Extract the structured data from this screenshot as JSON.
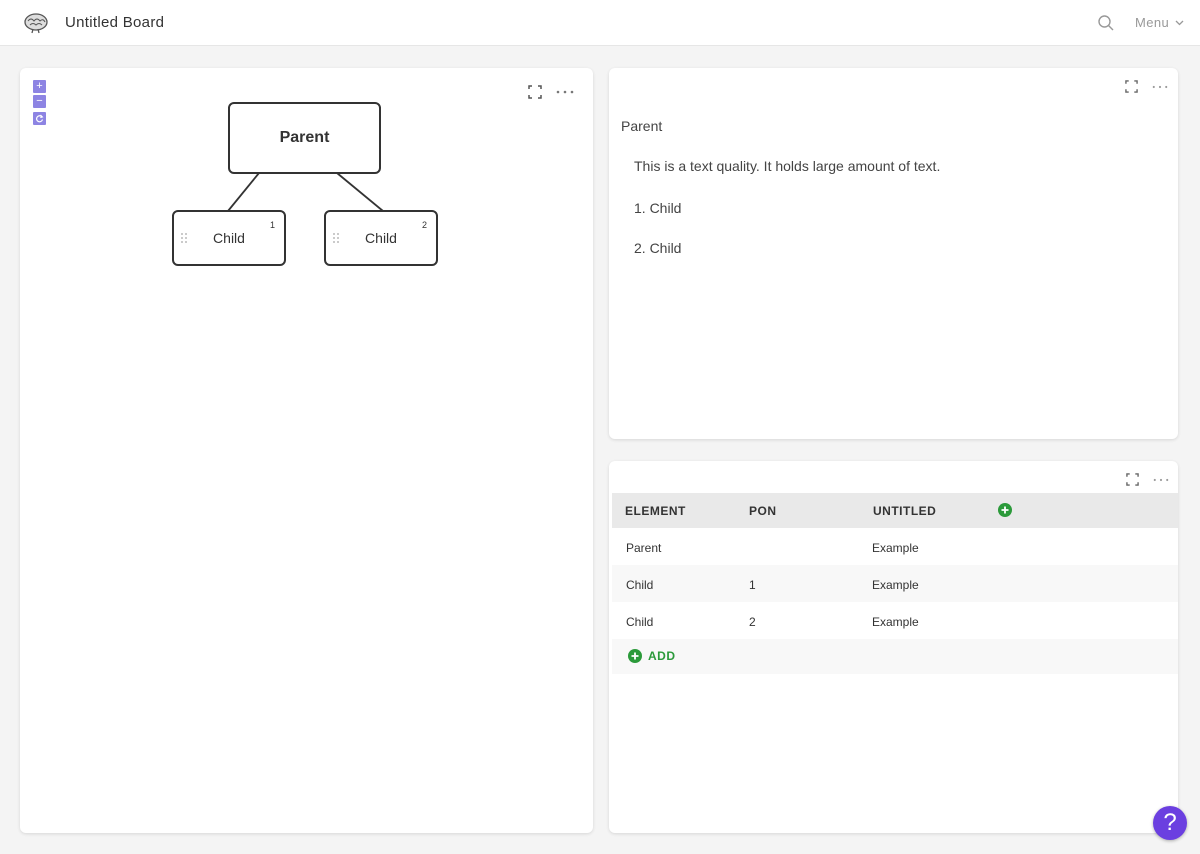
{
  "header": {
    "title": "Untitled Board",
    "menu_label": "Menu"
  },
  "diagram": {
    "zoom_in": "+",
    "zoom_out": "−",
    "nodes": [
      {
        "label": "Parent"
      },
      {
        "label": "Child",
        "number": "1"
      },
      {
        "label": "Child",
        "number": "2"
      }
    ]
  },
  "text_panel": {
    "heading": "Parent",
    "body": "This is a text quality. It holds large amount of text.",
    "list": [
      "1. Child",
      "2. Child"
    ]
  },
  "table": {
    "columns": [
      "ELEMENT",
      "PON",
      "UNTITLED"
    ],
    "rows": [
      [
        "Parent",
        "",
        "Example"
      ],
      [
        "Child",
        "1",
        "Example"
      ],
      [
        "Child",
        "2",
        "Example"
      ]
    ],
    "add_label": "ADD"
  },
  "help": {
    "label": "?"
  },
  "colors": {
    "accent": "#8d84e3",
    "add_green": "#2b9a3a",
    "help_purple": "#6b3fe0"
  }
}
